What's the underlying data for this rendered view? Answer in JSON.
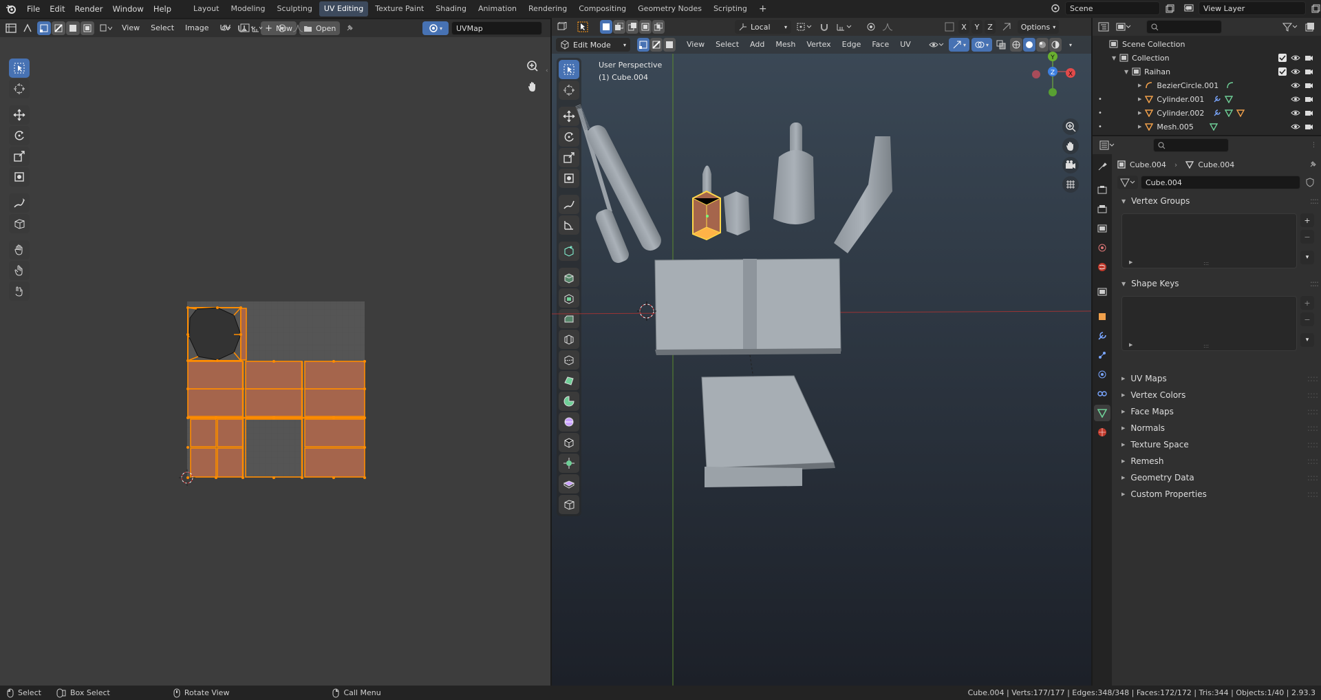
{
  "topbar": {
    "menus": [
      "File",
      "Edit",
      "Render",
      "Window",
      "Help"
    ],
    "workspaces": [
      "Layout",
      "Modeling",
      "Sculpting",
      "UV Editing",
      "Texture Paint",
      "Shading",
      "Animation",
      "Rendering",
      "Compositing",
      "Geometry Nodes",
      "Scripting"
    ],
    "active_workspace": "UV Editing",
    "scene": "Scene",
    "view_layer": "View Layer"
  },
  "uv_editor": {
    "menus": [
      "View",
      "Select",
      "Image",
      "UV"
    ],
    "new_label": "New",
    "open_label": "Open",
    "uvmap": "UVMap"
  },
  "viewport": {
    "mode": "Edit Mode",
    "menus": [
      "View",
      "Select",
      "Add",
      "Mesh",
      "Vertex",
      "Edge",
      "Face",
      "UV"
    ],
    "transform_orientation": "Local",
    "options_label": "Options",
    "overlay_title": "User Perspective",
    "overlay_object": "(1) Cube.004",
    "gizmo": {
      "x": "X",
      "y": "Y",
      "z": "Z"
    }
  },
  "outliner": {
    "scene_collection": "Scene Collection",
    "collection": "Collection",
    "sub_collection": "Raihan",
    "objects": [
      "BezierCircle.001",
      "Cylinder.001",
      "Cylinder.002",
      "Mesh.005"
    ]
  },
  "properties": {
    "object_name": "Cube.004",
    "mesh_name": "Cube.004",
    "data_field": "Cube.004",
    "panels_open": [
      "Vertex Groups",
      "Shape Keys"
    ],
    "panels_closed": [
      "UV Maps",
      "Vertex Colors",
      "Face Maps",
      "Normals",
      "Texture Space",
      "Remesh",
      "Geometry Data",
      "Custom Properties"
    ]
  },
  "statusbar": {
    "select": "Select",
    "box_select": "Box Select",
    "rotate_view": "Rotate View",
    "call_menu": "Call Menu",
    "stats": "Cube.004 | Verts:177/177 | Edges:348/348 | Faces:172/172 | Tris:344 | Objects:1/40 | 2.93.3"
  },
  "colors": {
    "accent": "#4772b3",
    "selection_orange": "#ff8c00",
    "uv_face_fill": "#a5654c",
    "viewport_bg_top": "#3c4a58",
    "viewport_bg_bottom": "#1c2028"
  }
}
